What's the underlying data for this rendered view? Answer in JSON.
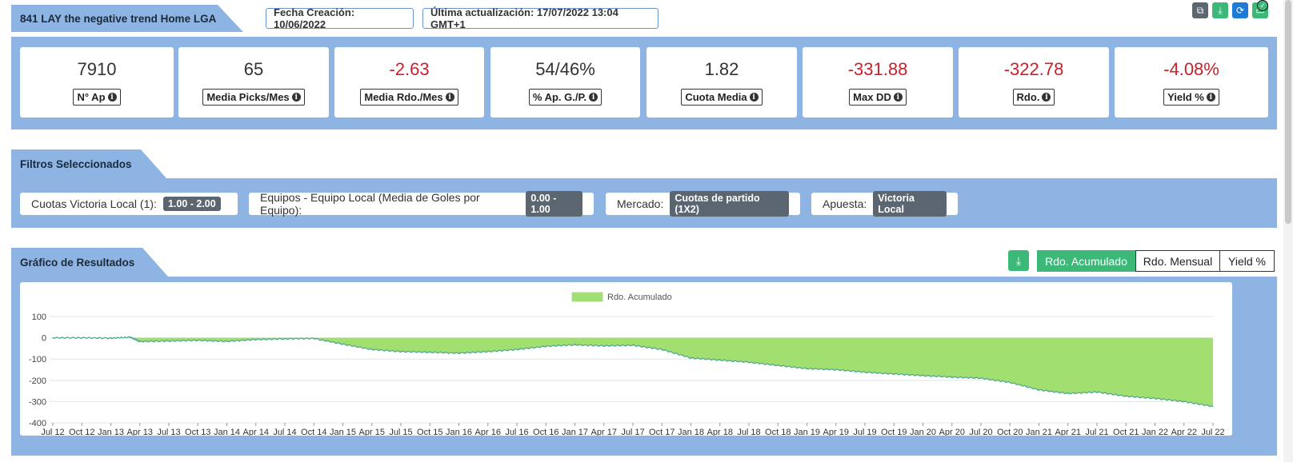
{
  "header": {
    "title": "841 LAY the negative trend Home LGA",
    "created": "Fecha Creación: 10/06/2022",
    "updated": "Última actualización: 17/07/2022 13:04 GMT+1"
  },
  "toolbar": {
    "icons": [
      "copy-icon",
      "download-icon",
      "refresh-icon",
      "save-icon",
      "check-icon"
    ]
  },
  "stats": [
    {
      "value": "7910",
      "label": "N° Ap",
      "negative": false
    },
    {
      "value": "65",
      "label": "Media Picks/Mes",
      "negative": false
    },
    {
      "value": "-2.63",
      "label": "Media Rdo./Mes",
      "negative": true
    },
    {
      "value": "54/46%",
      "label": "% Ap. G./P.",
      "negative": false
    },
    {
      "value": "1.82",
      "label": "Cuota Media",
      "negative": false
    },
    {
      "value": "-331.88",
      "label": "Max DD",
      "negative": true
    },
    {
      "value": "-322.78",
      "label": "Rdo.",
      "negative": true
    },
    {
      "value": "-4.08%",
      "label": "Yield %",
      "negative": true
    }
  ],
  "filters": {
    "title": "Filtros Seleccionados",
    "items": [
      {
        "label": "Cuotas Victoria Local (1):",
        "value": "1.00 - 2.00"
      },
      {
        "label": "Equipos - Equipo Local (Media de Goles por Equipo):",
        "value": "0.00 - 1.00"
      },
      {
        "label": "Mercado:",
        "value": "Cuotas de partido (1X2)"
      },
      {
        "label": "Apuesta:",
        "value": "Victoria Local"
      }
    ]
  },
  "results": {
    "title": "Gráfico de Resultados",
    "tabs": [
      "Rdo. Acumulado",
      "Rdo. Mensual",
      "Yield %"
    ],
    "active_tab": 0
  },
  "colors": {
    "band": "#8db4e2",
    "accent": "#3cb878",
    "negative": "#c9212b",
    "area": "#a1e070"
  },
  "chart_data": {
    "type": "area",
    "legend": "Rdo. Acumulado",
    "legend_position": "top-center",
    "grid": true,
    "ylim": [
      -400,
      100
    ],
    "yticks": [
      100,
      0,
      -100,
      -200,
      -300,
      -400
    ],
    "xticks": [
      "Jul 12",
      "Oct 12",
      "Jan 13",
      "Apr 13",
      "Jul 13",
      "Oct 13",
      "Jan 14",
      "Apr 14",
      "Jul 14",
      "Oct 14",
      "Jan 15",
      "Apr 15",
      "Jul 15",
      "Oct 15",
      "Jan 16",
      "Apr 16",
      "Jul 16",
      "Oct 16",
      "Jan 17",
      "Apr 17",
      "Jul 17",
      "Oct 17",
      "Jan 18",
      "Apr 18",
      "Jul 18",
      "Oct 18",
      "Jan 19",
      "Apr 19",
      "Jul 19",
      "Oct 19",
      "Jan 20",
      "Apr 20",
      "Jul 20",
      "Oct 20",
      "Jan 21",
      "Apr 21",
      "Jul 21",
      "Oct 21",
      "Jan 22",
      "Apr 22",
      "Jul 22"
    ],
    "x": [
      "Jul 12",
      "Oct 12",
      "Jan 13",
      "Mar 13",
      "Apr 13",
      "Jul 13",
      "Oct 13",
      "Jan 14",
      "Apr 14",
      "Jul 14",
      "Oct 14",
      "Jan 15",
      "Apr 15",
      "Jul 15",
      "Oct 15",
      "Jan 16",
      "Apr 16",
      "Jul 16",
      "Oct 16",
      "Jan 17",
      "Apr 17",
      "Jul 17",
      "Oct 17",
      "Jan 18",
      "Apr 18",
      "Jul 18",
      "Oct 18",
      "Jan 19",
      "Apr 19",
      "Jul 19",
      "Oct 19",
      "Jan 20",
      "Apr 20",
      "Jul 20",
      "Oct 20",
      "Jan 21",
      "Apr 21",
      "Jul 21",
      "Oct 21",
      "Jan 22",
      "Apr 22",
      "Jul 22"
    ],
    "series": [
      {
        "name": "Rdo. Acumulado",
        "values": [
          0,
          0,
          -2,
          3,
          -18,
          -15,
          -12,
          -17,
          -8,
          -5,
          -3,
          -30,
          -55,
          -65,
          -68,
          -72,
          -65,
          -55,
          -40,
          -33,
          -38,
          -35,
          -55,
          -95,
          -105,
          -115,
          -130,
          -145,
          -150,
          -162,
          -170,
          -178,
          -185,
          -190,
          -210,
          -245,
          -262,
          -255,
          -275,
          -285,
          -300,
          -323
        ]
      }
    ]
  }
}
